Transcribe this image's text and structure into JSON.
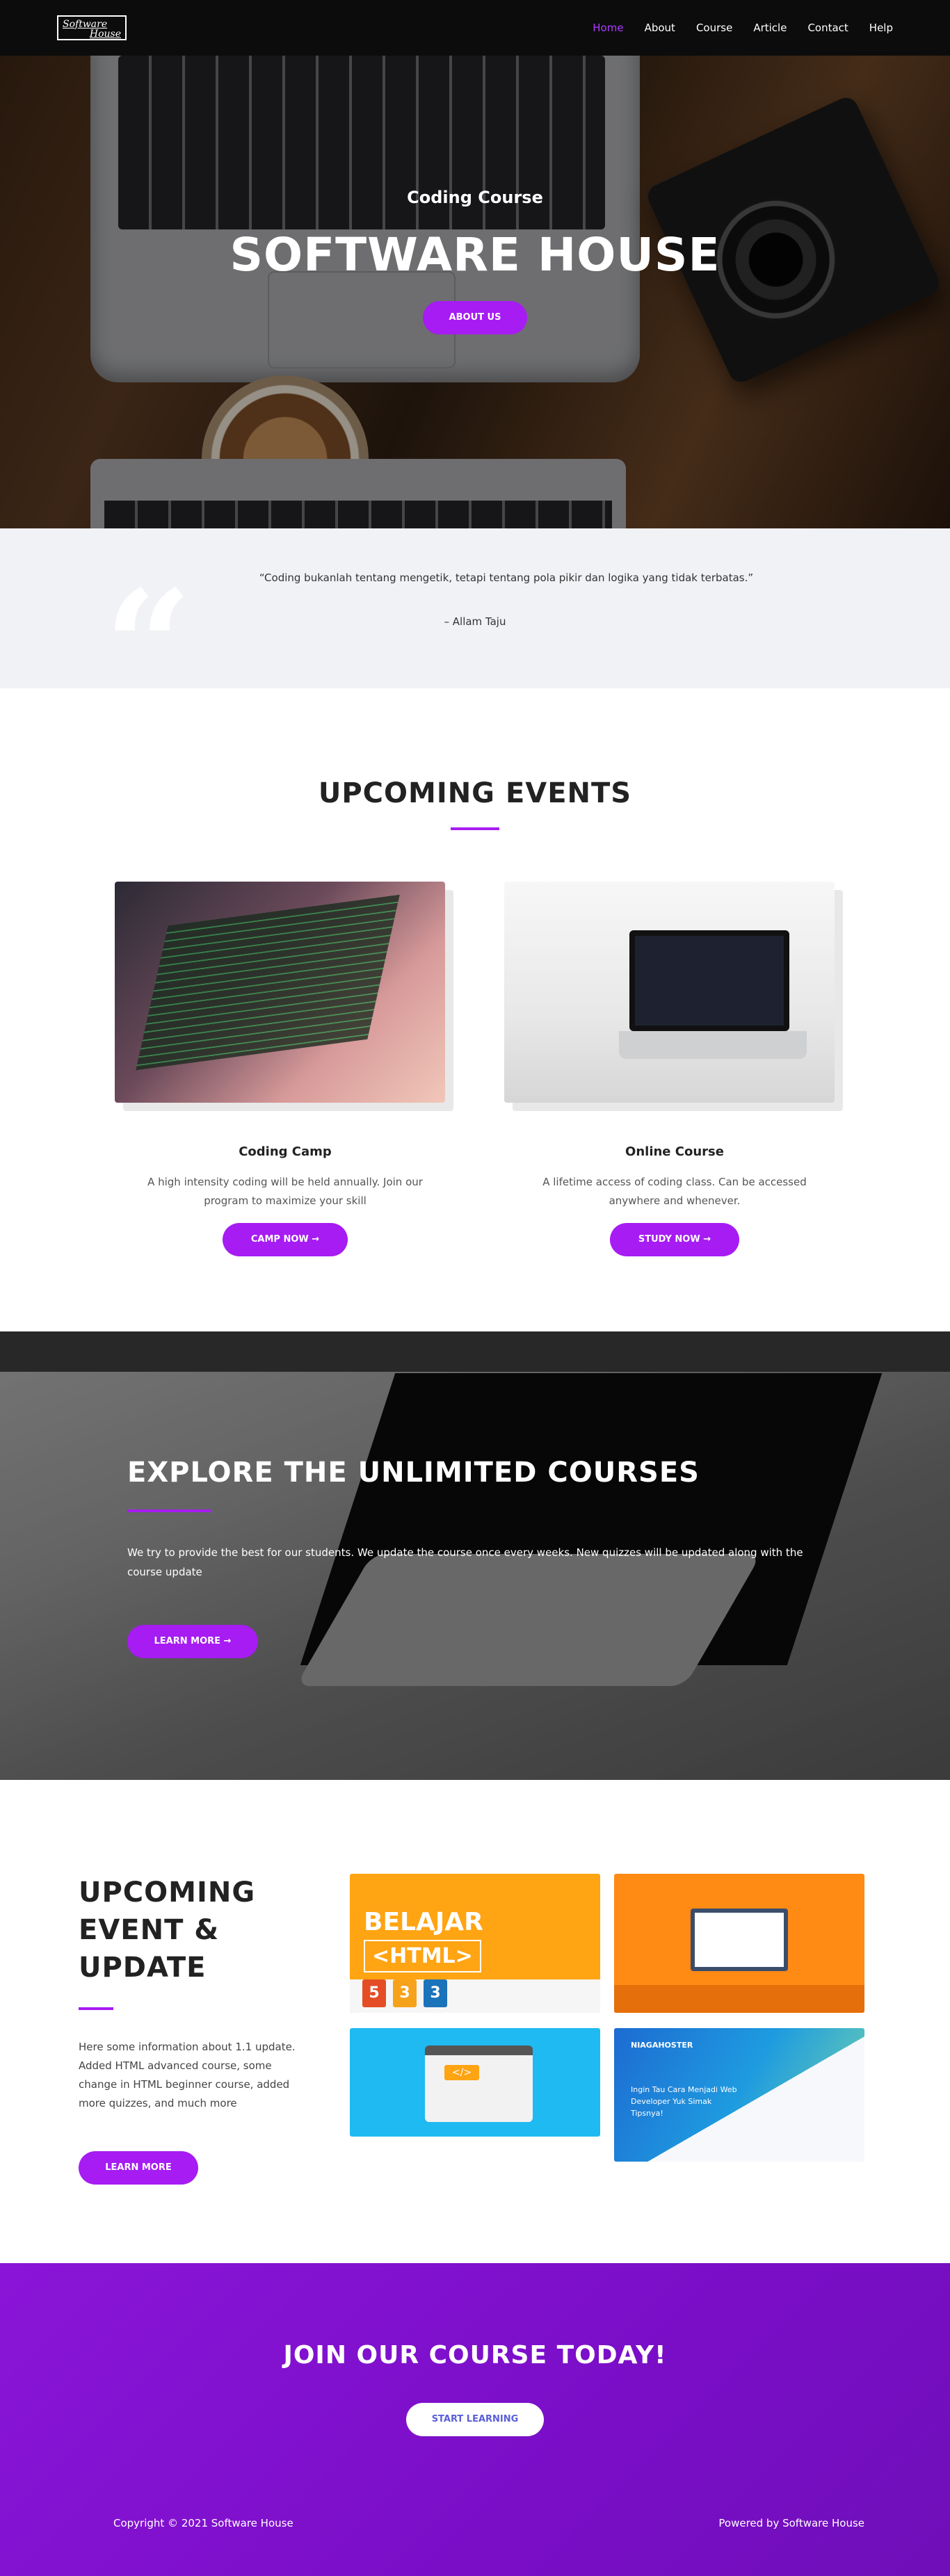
{
  "nav": {
    "logo_line1": "Software",
    "logo_line2": "House",
    "items": [
      {
        "label": "Home",
        "active": true
      },
      {
        "label": "About",
        "active": false
      },
      {
        "label": "Course",
        "active": false
      },
      {
        "label": "Article",
        "active": false
      },
      {
        "label": "Contact",
        "active": false
      },
      {
        "label": "Help",
        "active": false
      }
    ]
  },
  "hero": {
    "subtitle": "Coding Course",
    "title": "SOFTWARE HOUSE",
    "button": "ABOUT US"
  },
  "quote": {
    "mark": "“",
    "text": "“Coding bukanlah tentang mengetik, tetapi tentang pola pikir dan logika yang tidak terbatas.”",
    "author": "– Allam Taju"
  },
  "events": {
    "title": "UPCOMING EVENTS",
    "cards": [
      {
        "title": "Coding Camp",
        "desc": "A high intensity coding will be held annually. Join our program to maximize your skill",
        "button": "CAMP NOW →"
      },
      {
        "title": "Online Course",
        "desc": "A lifetime access of coding class. Can be accessed anywhere and whenever.",
        "button": "STUDY NOW →"
      }
    ]
  },
  "explore": {
    "title": "EXPLORE THE UNLIMITED COURSES",
    "desc": "We try to provide the best for our students. We update the course once every weeks. New quizzes will be updated along with the course update",
    "button": "LEARN MORE →"
  },
  "update": {
    "title": "UPCOMING EVENT & UPDATE",
    "desc": "Here some information about 1.1 update. Added HTML advanced course, some change in HTML beginner course, added more quizzes, and much more",
    "button": "LEARN MORE",
    "tile1_line1": "BELAJAR",
    "tile1_line2": "<HTML>",
    "tile1_icons": [
      "5",
      "3",
      "3"
    ],
    "tile3_code": "</>",
    "tile4_brand": "NIAGAHOSTER",
    "tile4_text": "Ingin Tau Cara Menjadi Web Developer Yuk Simak Tipsnya!"
  },
  "join": {
    "title": "JOIN OUR COURSE TODAY!",
    "button": "START LEARNING",
    "copyright": "Copyright © 2021 Software House",
    "powered": "Powered by Software House"
  },
  "colors": {
    "accent": "#a61cf2",
    "join_bg": "#7a0ec7"
  }
}
